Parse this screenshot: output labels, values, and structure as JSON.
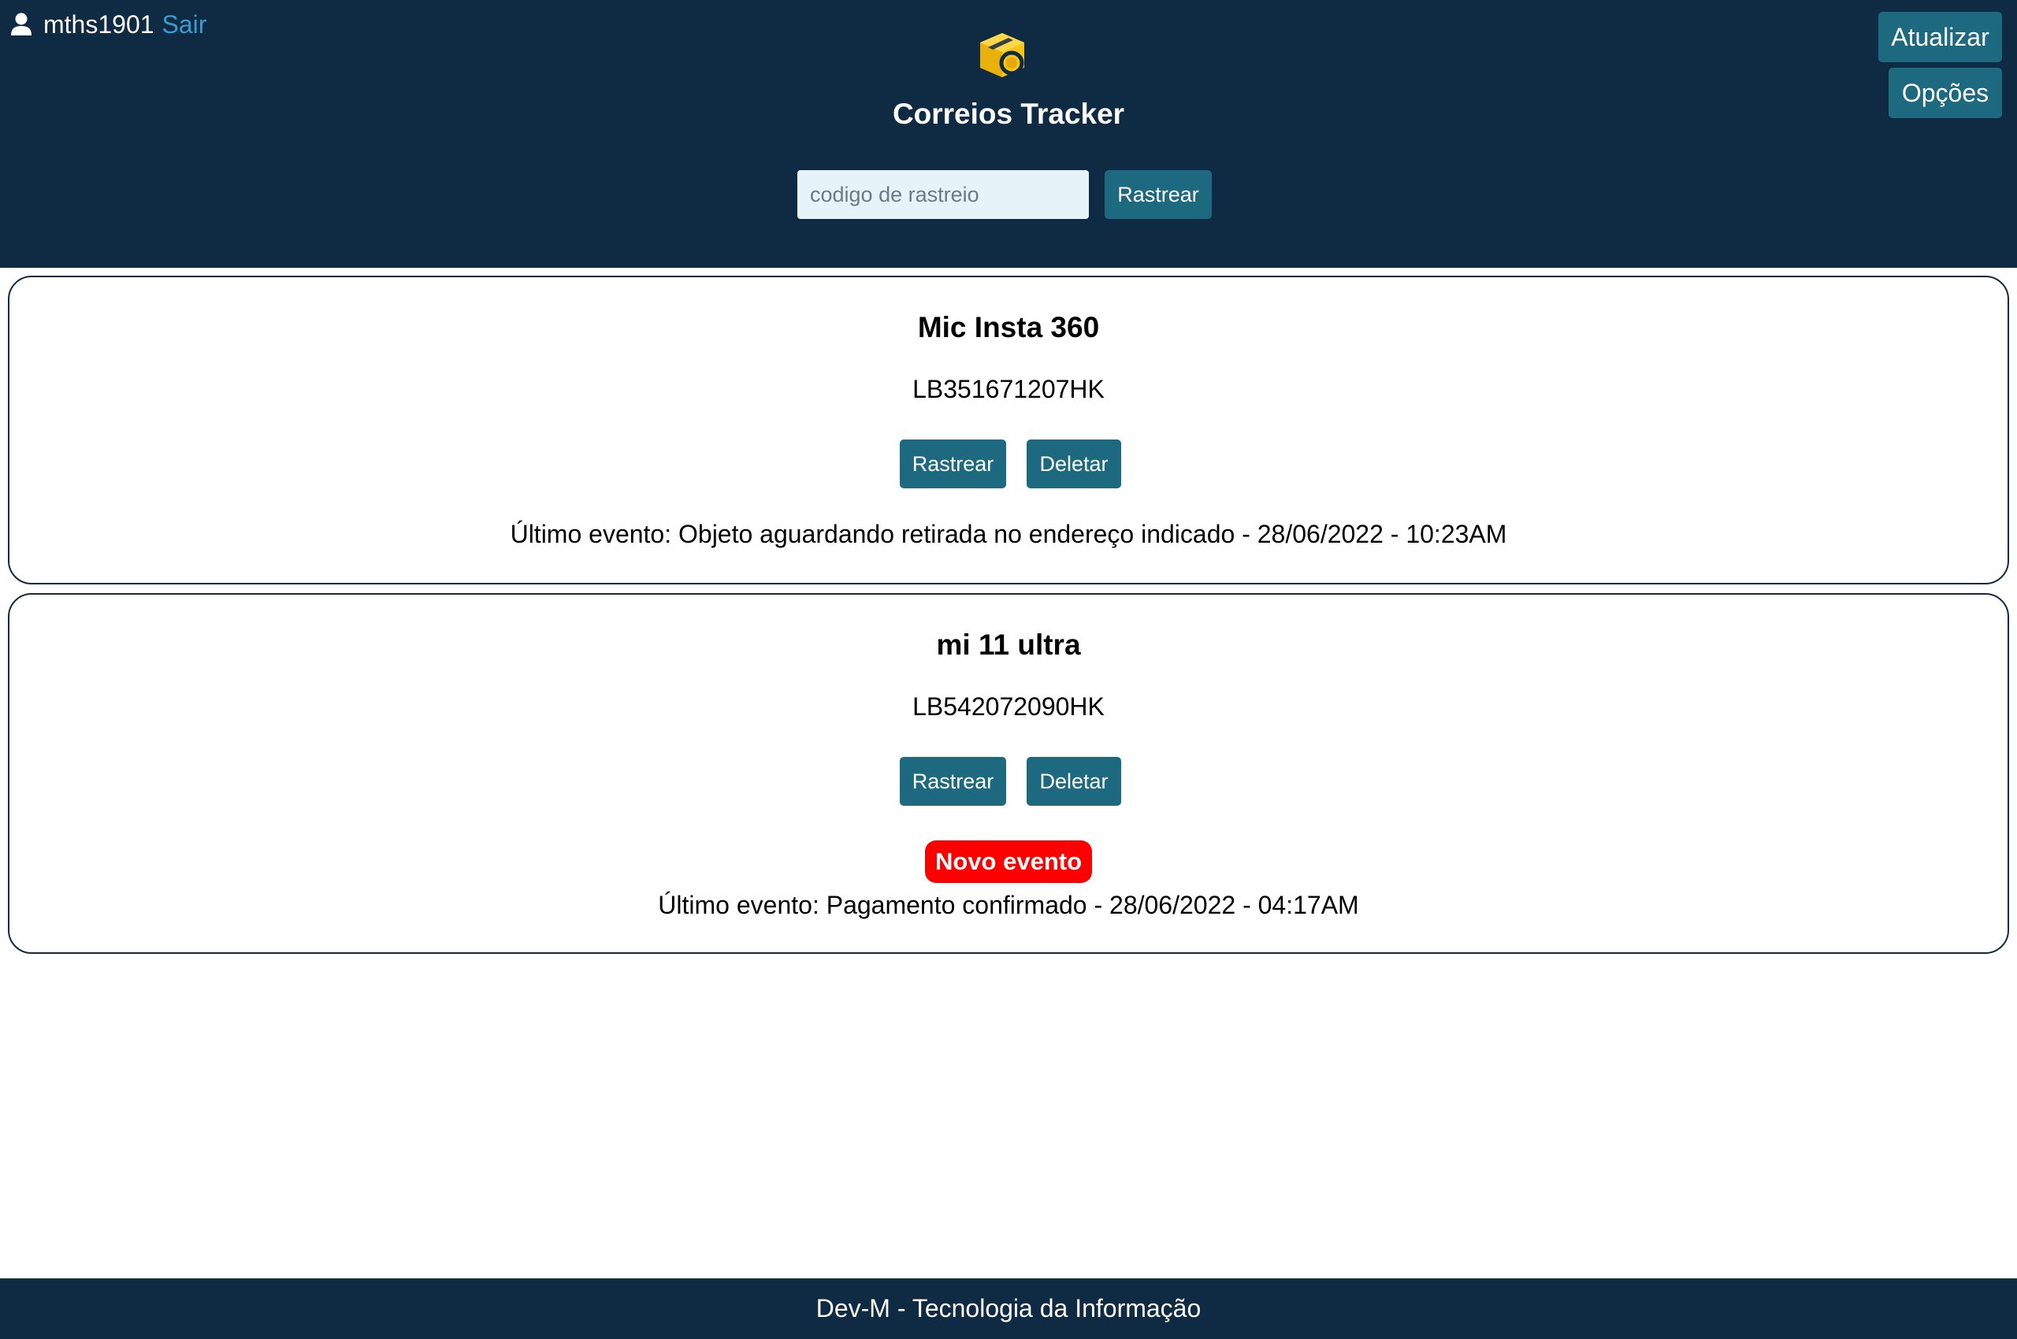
{
  "header": {
    "user": {
      "name": "mths1901",
      "logout_label": "Sair"
    },
    "title": "Correios Tracker",
    "search": {
      "placeholder": "codigo de rastreio",
      "value": "",
      "button_label": "Rastrear"
    },
    "update_label": "Atualizar",
    "options_label": "Opções"
  },
  "packages": [
    {
      "name": "Mic Insta 360",
      "code": "LB351671207HK",
      "track_label": "Rastrear",
      "delete_label": "Deletar",
      "new_event_badge": "",
      "last_event": "Último evento: Objeto aguardando retirada no endereço indicado - 28/06/2022 - 10:23AM"
    },
    {
      "name": "mi 11 ultra",
      "code": "LB542072090HK",
      "track_label": "Rastrear",
      "delete_label": "Deletar",
      "new_event_badge": "Novo evento",
      "last_event": "Último evento: Pagamento confirmado - 28/06/2022 - 04:17AM"
    }
  ],
  "footer": {
    "text": "Dev-M - Tecnologia da Informação"
  },
  "icons": {
    "user": "user-icon",
    "logo": "package-search-logo"
  },
  "colors": {
    "header_bg": "#0f2a43",
    "button_bg": "#1d6a80",
    "link": "#3b9bd0",
    "badge_bg": "#ff0000",
    "logo_yellow": "#f5c518"
  }
}
